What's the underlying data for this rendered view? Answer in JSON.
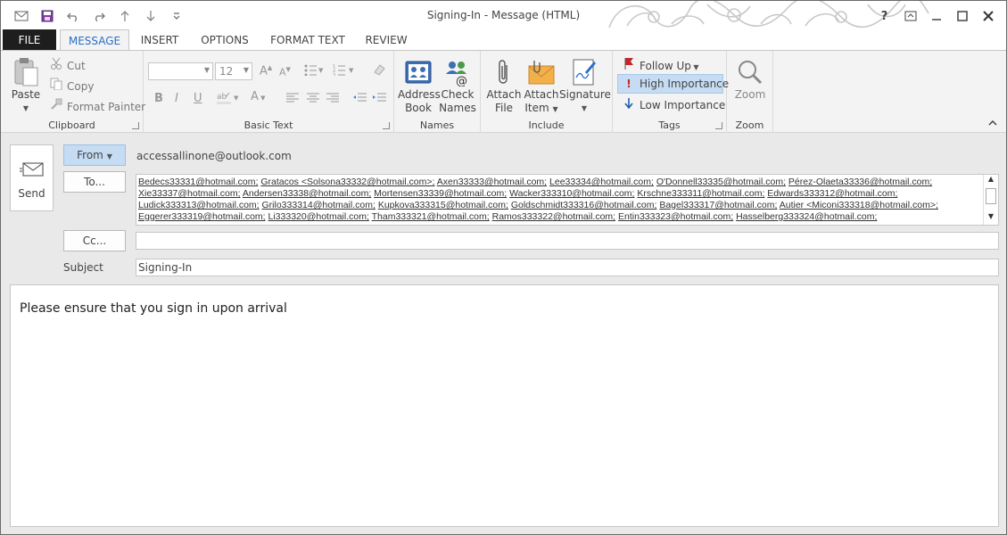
{
  "window": {
    "title": "Signing-In - Message (HTML)",
    "controls": [
      "?",
      "restore",
      "minimize",
      "maximize",
      "close"
    ]
  },
  "qat": {
    "icons": [
      "mail-icon",
      "save-icon",
      "undo-icon",
      "redo-icon",
      "up-icon",
      "down-icon",
      "customize-icon"
    ]
  },
  "tabs": [
    "FILE",
    "MESSAGE",
    "INSERT",
    "OPTIONS",
    "FORMAT TEXT",
    "REVIEW"
  ],
  "active_tab": "MESSAGE",
  "ribbon": {
    "clipboard": {
      "label": "Clipboard",
      "paste": "Paste",
      "cut": "Cut",
      "copy": "Copy",
      "format_painter": "Format Painter"
    },
    "basic_text": {
      "label": "Basic Text",
      "font_name": "",
      "font_size": "12",
      "bold": "B",
      "italic": "I",
      "underline": "U",
      "grow": "A",
      "shrink": "A",
      "font_color": "A"
    },
    "names": {
      "label": "Names",
      "address_book_1": "Address",
      "address_book_2": "Book",
      "check_names_1": "Check",
      "check_names_2": "Names"
    },
    "include": {
      "label": "Include",
      "attach_file_1": "Attach",
      "attach_file_2": "File",
      "attach_item_1": "Attach",
      "attach_item_2": "Item",
      "signature": "Signature"
    },
    "tags": {
      "label": "Tags",
      "follow_up": "Follow Up",
      "high_importance": "High Importance",
      "low_importance": "Low Importance"
    },
    "zoom": {
      "label": "Zoom",
      "zoom": "Zoom"
    }
  },
  "compose": {
    "send": "Send",
    "from_button": "From",
    "from_value": "accessallinone@outlook.com",
    "to_button": "To...",
    "to_recipients": [
      [
        "Bedecs33331@hotmail.com;",
        "Gratacos <Solsona33332@hotmail.com>;",
        "Axen33333@hotmail.com;",
        "Lee33334@hotmail.com;",
        "O'Donnell33335@hotmail.com;",
        "Pérez-Olaeta33336@hotmail.com;"
      ],
      [
        "Xie33337@hotmail.com;",
        "Andersen33338@hotmail.com;",
        "Mortensen33339@hotmail.com;",
        "Wacker333310@hotmail.com;",
        "Krschne333311@hotmail.com;",
        "Edwards333312@hotmail.com;"
      ],
      [
        "Ludick333313@hotmail.com;",
        "Grilo333314@hotmail.com;",
        "Kupkova333315@hotmail.com;",
        "Goldschmidt333316@hotmail.com;",
        "Bagel333317@hotmail.com;",
        "Autier <Miconi333318@hotmail.com>;"
      ],
      [
        "Eggerer333319@hotmail.com;",
        "Li333320@hotmail.com;",
        "Tham333321@hotmail.com;",
        "Ramos333322@hotmail.com;",
        "Entin333323@hotmail.com;",
        "Hasselberg333324@hotmail.com;"
      ]
    ],
    "cc_button": "Cc...",
    "cc_value": "",
    "subject_label": "Subject",
    "subject_value": "Signing-In",
    "body_text": "Please ensure that you sign in upon arrival"
  },
  "colors": {
    "accent": "#2a6ec6",
    "highlight": "#c5dcf3",
    "file_tab": "#1e1e1e",
    "flag_red": "#c0282c"
  }
}
